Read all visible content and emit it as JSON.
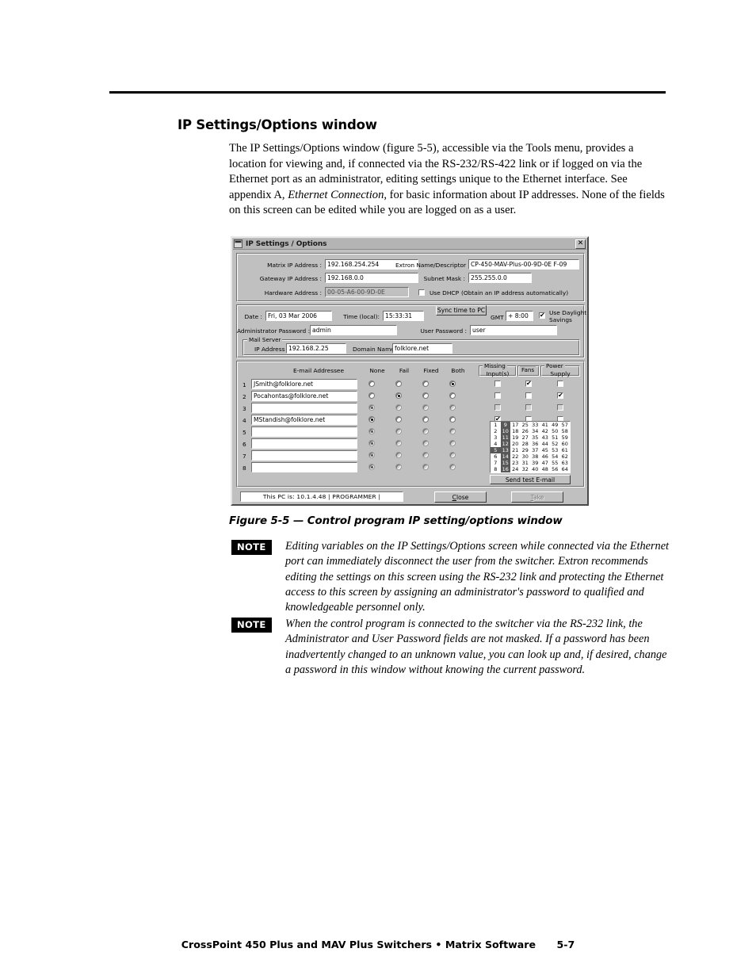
{
  "page": {
    "section_title": "IP Settings/Options window",
    "body_paragraph_html": "The IP Settings/Options window (figure 5-5), accessible via the Tools menu, provides a location for viewing and, if connected via the RS-232/RS-422 link or if logged on via the Ethernet port as an administrator, editing settings unique to the Ethernet interface.  See appendix A, <span class=\"ital\">Ethernet Connection</span>, for basic information about IP addresses.  None of the fields on this screen can be edited while you are logged on as a user.",
    "figure_caption": "Figure 5-5 — Control program IP setting/options window",
    "notes": [
      {
        "badge": "NOTE",
        "text": "Editing variables on the IP Settings/Options screen while connected via the Ethernet port can immediately disconnect the user from the switcher.  Extron recommends editing the settings on this screen using the RS-232 link and protecting the Ethernet access to this screen by assigning an administrator's password to qualified and knowledgeable personnel only."
      },
      {
        "badge": "NOTE",
        "text": "When the control program is connected to the switcher via the RS-232 link, the Administrator and User Password fields are not masked.  If a password has been inadvertently changed to an unknown value, you can look up and, if desired, change a password in this window without knowing the current password."
      }
    ],
    "footer": {
      "text": "CrossPoint 450 Plus and MAV Plus Switchers • Matrix Software",
      "page_number": "5-7"
    }
  },
  "dialog": {
    "title": "IP Settings / Options",
    "close_label": "✕",
    "network": {
      "matrix_ip_label": "Matrix IP Address :",
      "matrix_ip_value": "192.168.254.254",
      "gateway_ip_label": "Gateway IP Address :",
      "gateway_ip_value": "192.168.0.0",
      "hardware_address_label": "Hardware Address :",
      "hardware_address_value": "00-05-A6-00-9D-0E",
      "extron_name_label": "Extron Name/Descriptor :",
      "extron_name_value": "CP-450-MAV-Plus-00-9D-0E F-09",
      "subnet_mask_label": "Subnet Mask :",
      "subnet_mask_value": "255.255.0.0",
      "use_dhcp_label": "Use DHCP",
      "use_dhcp_hint": "(Obtain an IP address automatically)",
      "use_dhcp_checked": false
    },
    "time": {
      "date_label": "Date :",
      "date_value": "Fri, 03 Mar 2006",
      "time_label": "Time (local):",
      "time_value": "15:33:31",
      "sync_button": "Sync time to PC",
      "gmt_label": "GMT",
      "gmt_value": "+ 8:00",
      "daylight_label_line1": "Use Daylight",
      "daylight_label_line2": "Savings",
      "daylight_checked": true,
      "admin_password_label": "Administrator Password :",
      "admin_password_value": "admin",
      "user_password_label": "User Password :",
      "user_password_value": "user",
      "mail_server_caption": "Mail Server",
      "mail_ip_label": "IP Address",
      "mail_ip_value": "192.168.2.25",
      "domain_label": "Domain Name :",
      "domain_value": "folklore.net"
    },
    "email": {
      "column_header": "E-mail Addressee",
      "radio_headers": [
        "None",
        "Fail",
        "Fixed",
        "Both"
      ],
      "check_headers": [
        {
          "line1": "Missing",
          "line2": "Input(s)"
        },
        {
          "line1": "Fans",
          "line2": ""
        },
        {
          "line1": "Power",
          "line2": "Supply"
        }
      ],
      "rows": [
        {
          "num": "1",
          "address": "JSmith@folklore.net",
          "mode": "Both",
          "enabled": true,
          "missing": false,
          "fans": true,
          "power": false
        },
        {
          "num": "2",
          "address": "Pocahontas@folklore.net",
          "mode": "Fail",
          "enabled": true,
          "missing": false,
          "fans": false,
          "power": true
        },
        {
          "num": "3",
          "address": "",
          "mode": "None",
          "enabled": false,
          "missing": false,
          "fans": false,
          "power": false
        },
        {
          "num": "4",
          "address": "MStandish@folklore.net",
          "mode": "None",
          "enabled": true,
          "missing": true,
          "fans": false,
          "power": false
        },
        {
          "num": "5",
          "address": "",
          "mode": "None",
          "enabled": false,
          "missing": false,
          "fans": false,
          "power": false
        },
        {
          "num": "6",
          "address": "",
          "mode": "None",
          "enabled": false,
          "missing": false,
          "fans": false,
          "power": false
        },
        {
          "num": "7",
          "address": "",
          "mode": "None",
          "enabled": false,
          "missing": false,
          "fans": false,
          "power": false
        },
        {
          "num": "8",
          "address": "",
          "mode": "None",
          "enabled": false,
          "missing": false,
          "fans": false,
          "power": false
        }
      ],
      "send_test_button": "Send test E-mail",
      "number_grid": {
        "columns": 8,
        "rows": 8,
        "values": [
          [
            1,
            9,
            17,
            25,
            33,
            41,
            49,
            57
          ],
          [
            2,
            10,
            18,
            26,
            34,
            42,
            50,
            58
          ],
          [
            3,
            11,
            19,
            27,
            35,
            43,
            51,
            59
          ],
          [
            4,
            12,
            20,
            28,
            36,
            44,
            52,
            60
          ],
          [
            5,
            13,
            21,
            29,
            37,
            45,
            53,
            61
          ],
          [
            6,
            14,
            22,
            30,
            38,
            46,
            54,
            62
          ],
          [
            7,
            15,
            23,
            31,
            39,
            47,
            55,
            63
          ],
          [
            8,
            16,
            24,
            32,
            40,
            48,
            56,
            64
          ]
        ],
        "highlighted": [
          9,
          10,
          11,
          12,
          13,
          14,
          15,
          16,
          5
        ]
      }
    },
    "statusbar": {
      "text": "This PC is:  10.1.4.48   | PROGRAMMER |",
      "close_button": "Close",
      "close_button_accel": "C",
      "take_button": "Take",
      "take_button_accel": "T",
      "take_disabled": true
    }
  }
}
